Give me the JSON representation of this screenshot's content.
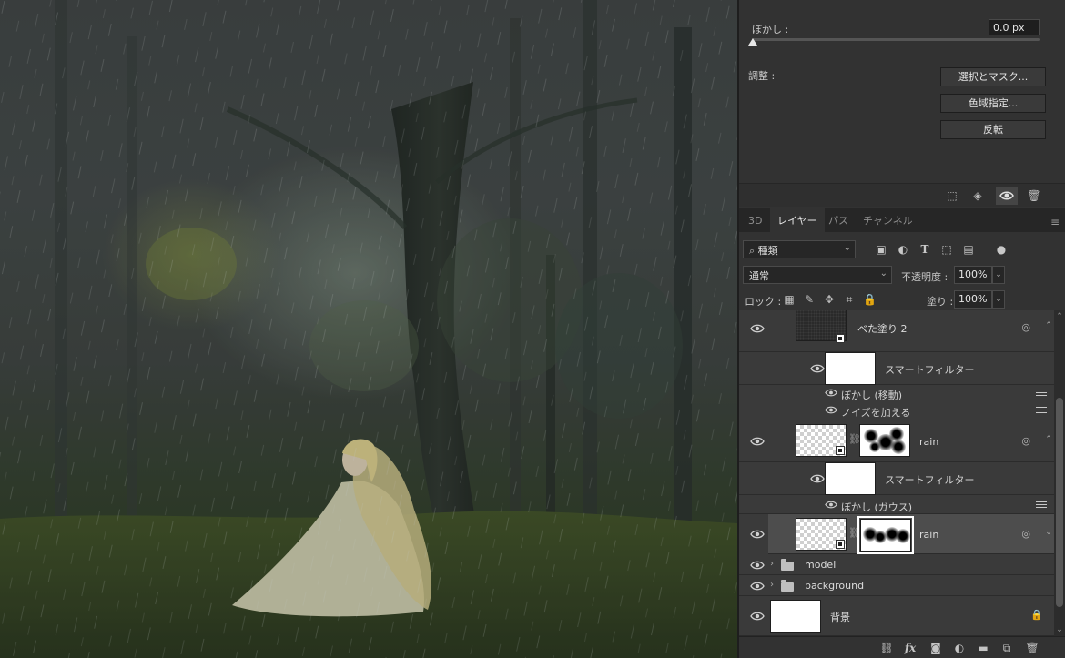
{
  "properties": {
    "blur_label": "ぼかし :",
    "blur_value": "0.0 px",
    "blur_slider": 0,
    "adjust_label": "調整 :",
    "buttons": [
      "選択とマスク...",
      "色域指定...",
      "反転"
    ]
  },
  "tabs": [
    {
      "label": "3D",
      "active": false
    },
    {
      "label": "レイヤー",
      "active": true
    },
    {
      "label": "パス",
      "active": false
    },
    {
      "label": "チャンネル",
      "active": false
    }
  ],
  "filter": {
    "kind_label": "種類"
  },
  "blend": {
    "mode": "通常",
    "opacity_label": "不透明度 :",
    "opacity": "100%"
  },
  "lock": {
    "label": "ロック :",
    "fill_label": "塗り :",
    "fill": "100%"
  },
  "layers": {
    "fill2": {
      "name": "べた塗り 2"
    },
    "smart_filter_1": {
      "label": "スマートフィルター"
    },
    "filter_motion": {
      "name": "ぼかし (移動)"
    },
    "filter_noise": {
      "name": "ノイズを加える"
    },
    "rain_1": {
      "name": "rain"
    },
    "smart_filter_2": {
      "label": "スマートフィルター"
    },
    "filter_gauss": {
      "name": "ぼかし (ガウス)"
    },
    "rain_2": {
      "name": "rain"
    },
    "model": {
      "name": "model"
    },
    "background_group": {
      "name": "background"
    },
    "background_layer": {
      "name": "背景"
    }
  },
  "colors": {
    "panel": "#323232",
    "layer_row": "#3a3a3a",
    "selected_row": "#4d4d4d"
  }
}
